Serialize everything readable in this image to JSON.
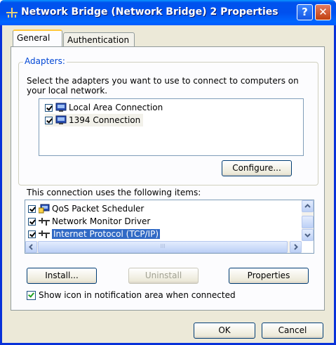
{
  "window": {
    "title": "Network Bridge (Network Bridge) 2 Properties",
    "help_glyph": "?",
    "close_glyph": "✕"
  },
  "tabs": [
    {
      "label": "General",
      "selected": true
    },
    {
      "label": "Authentication",
      "selected": false
    }
  ],
  "adapters": {
    "group_label": "Adapters:",
    "description": "Select the adapters you want to use to connect to computers on your local network.",
    "items": [
      {
        "label": "Local Area Connection",
        "checked": true,
        "icon": "network-adapter-icon"
      },
      {
        "label": "1394 Connection",
        "checked": true,
        "icon": "network-adapter-icon"
      }
    ],
    "configure_label": "Configure..."
  },
  "components": {
    "label": "This connection uses the following items:",
    "items": [
      {
        "label": "QoS Packet Scheduler",
        "checked": true,
        "icon": "scheduler-icon"
      },
      {
        "label": "Network Monitor Driver",
        "checked": true,
        "icon": "protocol-icon"
      },
      {
        "label": "Internet Protocol (TCP/IP)",
        "checked": true,
        "icon": "protocol-icon",
        "selected": true
      }
    ],
    "hscroll_thumb": "III",
    "install_label": "Install...",
    "uninstall_label": "Uninstall",
    "properties_label": "Properties"
  },
  "notify": {
    "label": "Show icon in notification area when connected",
    "checked": true
  },
  "footer": {
    "ok_label": "OK",
    "cancel_label": "Cancel"
  },
  "colors": {
    "titlebar": "#0053ee",
    "selection": "#316ac5",
    "group_label": "#0046d5"
  }
}
